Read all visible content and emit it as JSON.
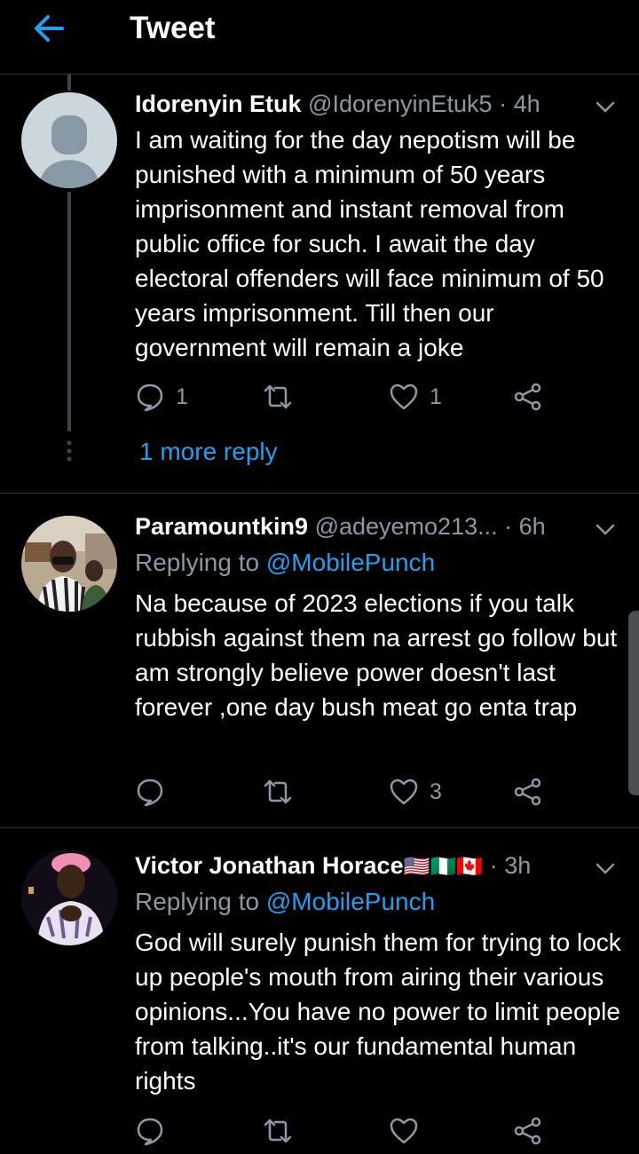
{
  "header": {
    "title": "Tweet"
  },
  "thread_more": {
    "label": "1 more reply"
  },
  "tweets": [
    {
      "name": "Idorenyin Etuk",
      "handle": "@IdorenyinEtuk5",
      "separator": "·",
      "time": "4h",
      "replying_prefix": "",
      "replying_to": "",
      "text": "I am waiting for the day nepotism will be punished with a minimum of 50 years imprisonment and instant removal from public office for such. I await the day electoral offenders will face minimum of 50 years imprisonment. Till then our government will remain a joke",
      "reply_count": "1",
      "retweet_count": "",
      "like_count": "1"
    },
    {
      "name": "Paramountkin9",
      "handle": "@adeyemo213...",
      "separator": "·",
      "time": "6h",
      "replying_prefix": "Replying to",
      "replying_to": "@MobilePunch",
      "text": "Na because of 2023 elections if you talk rubbish against them na arrest go follow but am strongly believe power doesn't last forever ,one day bush meat go enta trap",
      "reply_count": "",
      "retweet_count": "",
      "like_count": "3"
    },
    {
      "name": "Victor Jonathan Horace",
      "handle": "",
      "separator": "·",
      "time": "3h",
      "flags": "🇺🇸🇳🇬🇨🇦",
      "replying_prefix": "Replying to",
      "replying_to": "@MobilePunch",
      "text": "God will surely punish them for trying to lock up people's mouth from airing their various opinions...You have no power to limit people from talking..it's our fundamental human rights",
      "reply_count": "",
      "retweet_count": "",
      "like_count": ""
    }
  ],
  "icons": {
    "back": "arrow-left-icon",
    "caret": "chevron-down-icon",
    "reply": "comment-icon",
    "retweet": "retweet-icon",
    "like": "heart-icon",
    "share": "share-icon"
  },
  "colors": {
    "background": "#000000",
    "accent": "#1da1f2",
    "secondary_text": "#8b98a5",
    "divider": "#2f3336"
  }
}
